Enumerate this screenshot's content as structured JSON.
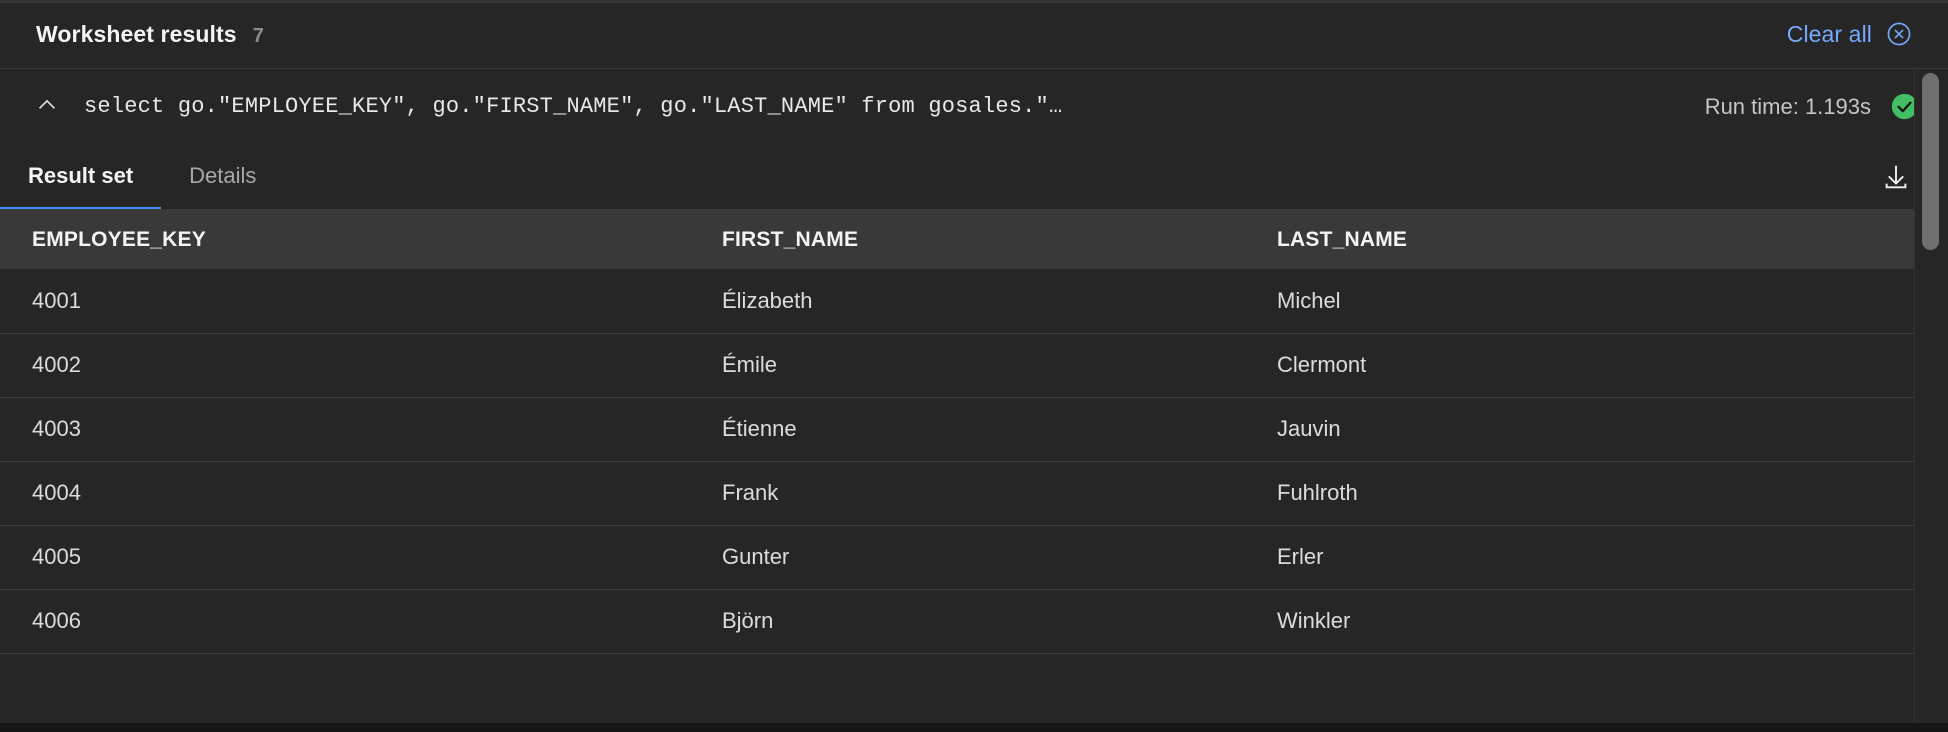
{
  "header": {
    "title": "Worksheet results",
    "count": "7",
    "clear_all_label": "Clear all",
    "clear_all_icon": "close-circle-icon",
    "accent_color": "#78a9ff"
  },
  "query": {
    "collapse_icon": "chevron-up-icon",
    "sql": "select go.\"EMPLOYEE_KEY\", go.\"FIRST_NAME\", go.\"LAST_NAME\" from gosales.\"…",
    "run_time_label": "Run time: 1.193s",
    "status_icon": "checkmark-filled-icon",
    "status_color": "#42be65"
  },
  "tabs": {
    "items": [
      {
        "label": "Result set",
        "active": true
      },
      {
        "label": "Details",
        "active": false
      }
    ],
    "download_icon": "download-icon",
    "active_indicator_color": "#4589ff"
  },
  "table": {
    "columns": [
      "EMPLOYEE_KEY",
      "FIRST_NAME",
      "LAST_NAME"
    ],
    "rows": [
      [
        "4001",
        "Élizabeth",
        "Michel"
      ],
      [
        "4002",
        "Émile",
        "Clermont"
      ],
      [
        "4003",
        "Étienne",
        "Jauvin"
      ],
      [
        "4004",
        "Frank",
        "Fuhlroth"
      ],
      [
        "4005",
        "Gunter",
        "Erler"
      ],
      [
        "4006",
        "Björn",
        "Winkler"
      ]
    ]
  }
}
